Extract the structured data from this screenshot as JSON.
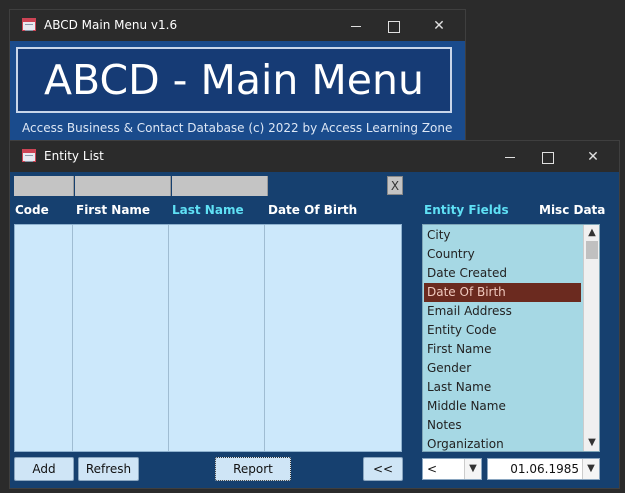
{
  "main_window": {
    "title": "ABCD Main Menu v1.6",
    "banner": "ABCD - Main Menu",
    "footer": "Access Business & Contact Database (c) 2022 by Access Learning Zone"
  },
  "entity_window": {
    "title": "Entity List",
    "clear_label": "X",
    "columns": [
      "Code",
      "First Name",
      "Last Name",
      "Date Of Birth"
    ],
    "active_column": "Last Name",
    "fields_header": "Entity Fields",
    "misc_header": "Misc Data",
    "fields": [
      "City",
      "Country",
      "Date Created",
      "Date Of Birth",
      "Email Address",
      "Entity Code",
      "First Name",
      "Gender",
      "Last Name",
      "Middle Name",
      "Notes",
      "Organization"
    ],
    "selected_field": "Date Of Birth",
    "buttons": {
      "add": "Add",
      "refresh": "Refresh",
      "report": "Report",
      "collapse": "<<"
    },
    "operator_value": "<",
    "date_value": "01.06.1985"
  },
  "controls": {
    "minimize": "—",
    "close": "✕"
  },
  "colors": {
    "main_bg": "#1a4b8c",
    "entity_bg": "#16406f",
    "selected_field_bg": "#6b2a1f",
    "active_header": "#5fe0f5"
  }
}
